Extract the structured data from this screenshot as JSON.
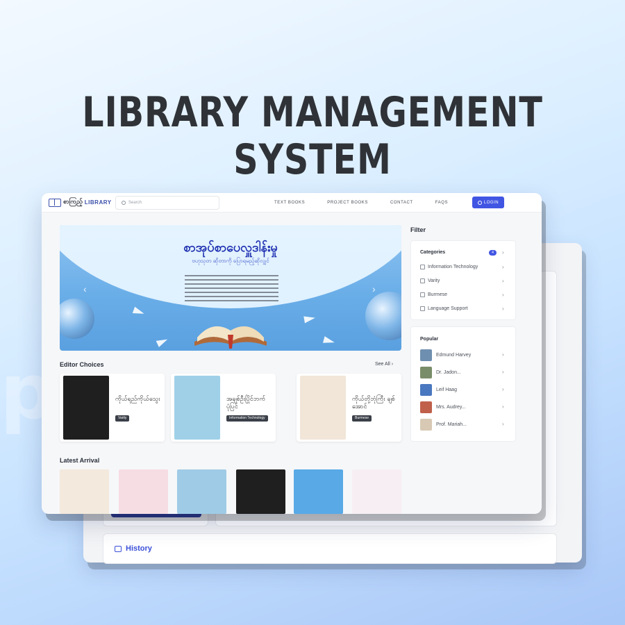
{
  "hero": {
    "line1": "LIBRARY MANAGEMENT",
    "line2": "SYSTEM"
  },
  "back_window": {
    "history_label": "History"
  },
  "navbar": {
    "logo_mm": "စာကြည့်",
    "logo_text": "LIBRARY",
    "search_placeholder": "Search",
    "links": [
      "TEXT BOOKS",
      "PROJECT BOOKS",
      "CONTACT",
      "FAQS"
    ],
    "login_label": "LOGIN"
  },
  "banner": {
    "title": "စာအုပ်စာပေလှူဒါန်းမှု",
    "subtitle": "ဗဟုသုတ ဆိုတာကို ပြောရမည့်ဆိုလျှင်",
    "prev_icon": "chevron-left-icon",
    "next_icon": "chevron-right-icon"
  },
  "editor_choices": {
    "title": "Editor Choices",
    "see_all": "See All",
    "items": [
      {
        "title": "ကိုယ်ရည်ကိုယ်သွေး",
        "badge": "Varity",
        "cover_color": "#1f1f1f"
      },
      {
        "title": "အချစ်ဦးပြိုင်ဘက် ပုံပြင်",
        "badge": "Information Technology",
        "cover_color": "#9fd0e8"
      },
      {
        "title": "ကိုယ်တို့ဘုံကြီး ချစ်အောင်",
        "badge": "Burmese",
        "cover_color": "#f1e6d8"
      }
    ]
  },
  "latest_arrival": {
    "title": "Latest Arrival",
    "covers": [
      "#f3e9dc",
      "#f6dde3",
      "#9fcbe6",
      "#1f1f1f",
      "#58a9e6",
      "#f7eef4"
    ]
  },
  "filter": {
    "title": "Filter",
    "categories_label": "Categories",
    "categories_count": "4",
    "categories": [
      "Information Technology",
      "Varity",
      "Burmese",
      "Language Support"
    ],
    "popular_label": "Popular",
    "popular": [
      {
        "name": "Edmund Harvey",
        "color": "#6f8fb0"
      },
      {
        "name": "Dr. Jadon...",
        "color": "#7a8d6a"
      },
      {
        "name": "Leif Haag",
        "color": "#4a78c0"
      },
      {
        "name": "Mrs. Audrey...",
        "color": "#c0604a"
      },
      {
        "name": "Prof. Mariah...",
        "color": "#d8c9b4"
      }
    ]
  }
}
